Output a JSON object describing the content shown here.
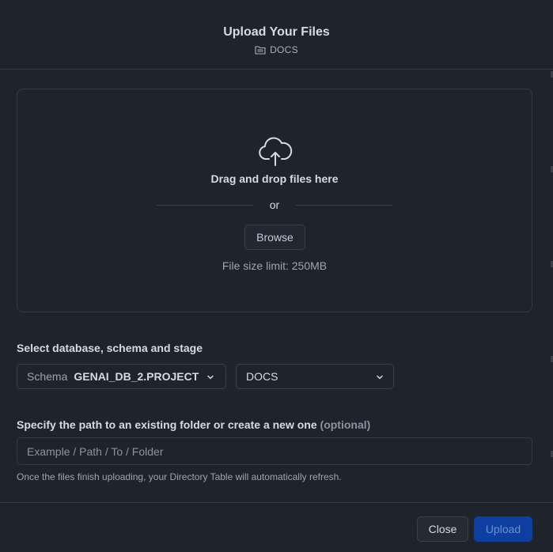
{
  "header": {
    "title": "Upload Your Files",
    "stage_name": "DOCS",
    "stage_icon": "folder-icon"
  },
  "dropzone": {
    "icon": "cloud-upload-icon",
    "drag_text": "Drag and drop files here",
    "or_text": "or",
    "browse_label": "Browse",
    "size_limit": "File size limit: 250MB"
  },
  "location": {
    "label": "Select database, schema and stage",
    "schema_prefix": "Schema",
    "schema_value": "GENAI_DB_2.PROJECT",
    "stage_value": "DOCS"
  },
  "path": {
    "label": "Specify the path to an existing folder or create a new one",
    "optional": "(optional)",
    "placeholder": "Example / Path / To / Folder",
    "value": "",
    "hint": "Once the files finish uploading, your Directory Table will automatically refresh."
  },
  "footer": {
    "close_label": "Close",
    "upload_label": "Upload"
  },
  "colors": {
    "background": "#1f232c",
    "primary_button": "#0d3fa0",
    "border": "#343946"
  }
}
